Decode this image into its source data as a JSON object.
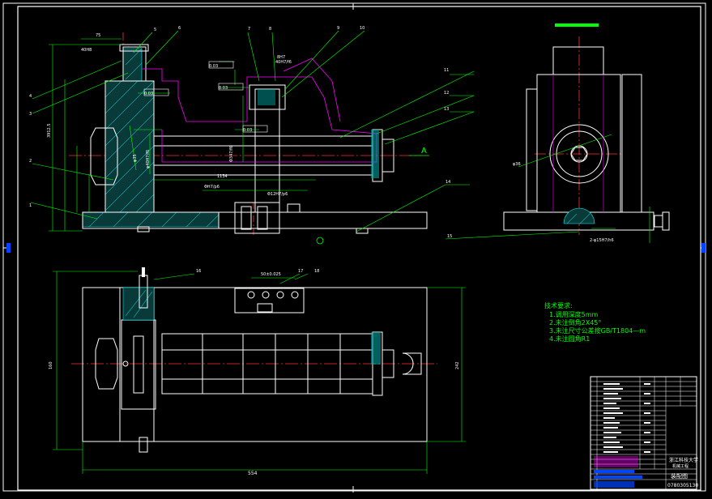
{
  "colors": {
    "background": "#000000",
    "outline": "#ffffff",
    "frame": "#ffffff",
    "dimension": "#00ff00",
    "centerline": "#ff3030",
    "hatch": "#00ffff",
    "phantom": "#ff00ff",
    "accent_yellow": "#ffff00",
    "title_bar": "#00ff00",
    "view_marker": "#0044ff"
  },
  "callouts": {
    "front": [
      "1",
      "2",
      "3",
      "4",
      "5",
      "6",
      "7",
      "8",
      "9",
      "10",
      "11",
      "12",
      "13"
    ],
    "plan": [
      "16",
      "17",
      "18"
    ],
    "side": [
      "14",
      "15"
    ]
  },
  "front_view": {
    "dims": [
      "75",
      "40H8",
      "40H7/f6",
      "3912.5",
      "8H7",
      "Φ347/f6",
      "φ35",
      "φ40H7/f6",
      "1134",
      "ΦH7/p6",
      "Φ12H7/p6"
    ],
    "tolerance_frames": [
      "0.03",
      "0.03",
      "0.03",
      "0.03"
    ],
    "section_label": "A"
  },
  "side_view": {
    "dims": [
      "φ36",
      "2-φ15H7/h6"
    ]
  },
  "plan_view": {
    "dims": [
      "50±0.025",
      "160",
      "554",
      "242",
      "320"
    ]
  },
  "notes": {
    "heading": "技术要求:",
    "items": [
      "1.调用深度5mm",
      "2.未注倒角2X45°",
      "3.未注尺寸公差按GB/T1804—m",
      "4.未注圆角R1"
    ]
  },
  "title_block": {
    "org": "浙江科技大学",
    "sub": "机械工程",
    "drawing_title": "装配图",
    "drawing_no": "0780305130"
  }
}
